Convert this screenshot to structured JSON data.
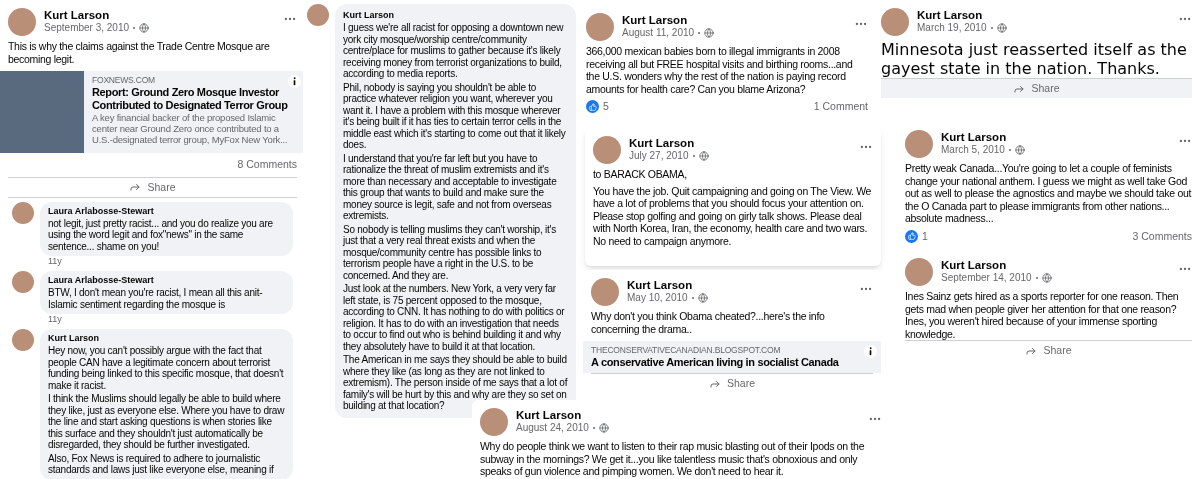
{
  "cards": [
    {
      "kind": "post",
      "author": "Kurt Larson",
      "date": "September 3, 2010",
      "text": [
        "This is why the claims against the Trade Centre Mosque are becoming legit."
      ],
      "link": {
        "image": true,
        "info": true,
        "domain": "FOXNEWS.COM",
        "title": "Report: Ground Zero Mosque Investor Contributed to Designated Terror Group",
        "description": "A key financial backer of the proposed Islamic center near Ground Zero once contributed to a U.S.-designated terror group, MyFox New York..."
      },
      "comments_count": "8 Comments",
      "share": "Share",
      "comments": [
        {
          "author": "Laura Arlabosse-Stewart",
          "paragraphs": [
            "not legit, just pretty racist... and you do realize you are using the word legit and fox\"news\" in the same sentence... shame on you!"
          ],
          "age": "11y"
        },
        {
          "author": "Laura Arlabosse-Stewart",
          "paragraphs": [
            "BTW, I don't mean you're racist, I mean all this anit-Islamic sentiment regarding the mosque is"
          ],
          "age": "11y"
        },
        {
          "author": "Kurt Larson",
          "paragraphs": [
            "Hey now, you can't possibly argue with the fact that people CAN have a legitimate concern about terrorist funding being linked to this specific mosque, that doesn't make it racist.",
            "I think the Muslims should legally be able to build where they like, just as everyone else. Where you have to draw the line and start asking questions is when stories like this surface and they shouldn't just automatically be disregarded, they should be further investigated.",
            "Also, Fox News is required to adhere to journalistic standards and laws just like everyone else, meaning if"
          ]
        }
      ]
    },
    {
      "kind": "comment",
      "author": "Kurt Larson",
      "paragraphs": [
        "I guess we're all racist for opposing a downtown new york city mosque/worship centre/community centre/place for muslims to gather because it's likely receiving money from terrorist organizations to build, according to media reports.",
        "Phil, nobody is saying you shouldn't be able to practice whatever religion you want, wherever you want it. I have a problem with this mosque wherever it's being built if it has ties to certain terror cells in the middle east which it's starting to come out that it likely does.",
        "I understand that you're far left but you have to rationalize the threat of muslim extremists and it's more than necessary and acceptable to investigate this group that wants to build and make sure the money source is legit, safe and not from overseas extremists.",
        "So nobody is telling muslims they can't worship, it's just that a very real threat exists and when the mosque/community centre has possible links to terrorism people have a right in the U.S. to be concerned. And they are.",
        "Just look at the numbers. New York, a very very far left state, is 75 percent opposed to the mosque, according to CNN. It has nothing to do with politics or religion. It has to do with an investigation that needs to occur to find out who is behind building it and why they absolutely have to build it at that location.",
        "The American in me says they should be able to build where they like (as long as they are not linked to extremism). The person inside of me says that a lot of family's will be hurt by this and why are they so set on building at that location?"
      ]
    },
    {
      "kind": "post",
      "author": "Kurt Larson",
      "date": "August 11, 2010",
      "text": [
        "366,000 mexican babies born to illegal immigrants in 2008 receiving all but FREE hospital visits and birthing rooms...and the U.S. wonders why the rest of the nation is paying record amounts for health care? Can you blame Arizona?"
      ],
      "likes": "5",
      "comments_count": "1 Comment"
    },
    {
      "kind": "post",
      "author": "Kurt Larson",
      "date": "July 27, 2010",
      "text": [
        "to BARACK OBAMA,",
        "You have the job. Quit campaigning and going on The View. We have a lot of problems that you should focus your attention on. Please stop golfing and going on girly talk shows. Please deal with North Korea, Iran, the economy, health care and two wars. No need to campaign anymore."
      ]
    },
    {
      "kind": "post",
      "author": "Kurt Larson",
      "date": "May 10, 2010",
      "text": [
        "Why don't you think Obama cheated?...here's the info concerning the drama.."
      ],
      "link": {
        "image": false,
        "info": true,
        "domain": "THECONSERVATIVECANADIAN.BLOGSPOT.COM",
        "title": "A conservative American living in socialist Canada"
      },
      "share": "Share"
    },
    {
      "kind": "post",
      "author": "Kurt Larson",
      "date": "March 19, 2010",
      "text": [
        "Minnesota just reasserted itself as the gayest state in the nation. Thanks."
      ],
      "share": "Share"
    },
    {
      "kind": "post",
      "author": "Kurt Larson",
      "date": "March 5, 2010",
      "text": [
        "Pretty weak Canada...You're going to let a couple of feminists change your national anthem. I guess we might as well take God out as well to please the agnostics and maybe we should take out the O Canada part to please immigrants from other nations... absolute madness..."
      ],
      "likes": "1",
      "comments_count": "3 Comments"
    },
    {
      "kind": "post",
      "author": "Kurt Larson",
      "date": "September 14, 2010",
      "text": [
        "Ines Sainz gets hired as a sports reporter for one reason. Then gets mad when people giver her attention for that one reason? Ines, you weren't hired because of your immense sporting knowledge."
      ],
      "share": "Share"
    },
    {
      "kind": "post",
      "author": "Kurt Larson",
      "date": "August 24, 2010",
      "text": [
        "Why do people think we want to listen to their rap music blasting out of their Ipods on the subway in the mornings? We get it...you like talentless music that's obnoxious and only speaks of gun violence and pimping women. We don't need to hear it."
      ]
    }
  ]
}
